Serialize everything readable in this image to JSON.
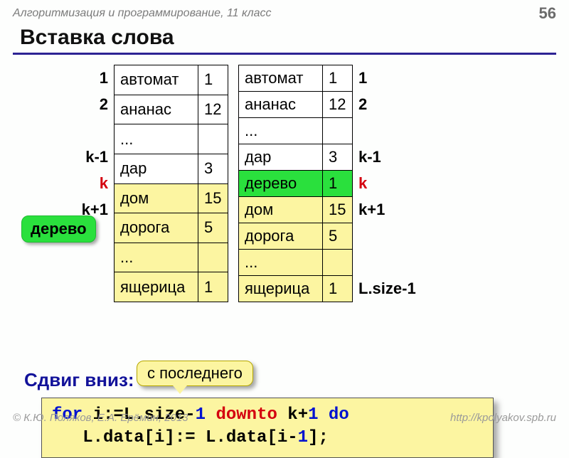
{
  "header": {
    "course": "Алгоритмизация и программирование, 11 класс",
    "page": "56"
  },
  "title": "Вставка слова",
  "left_indices": [
    "1",
    "2",
    "",
    "k-1",
    "k",
    "k+1",
    "",
    ""
  ],
  "left_red": [
    false,
    false,
    false,
    false,
    true,
    false,
    false,
    false
  ],
  "left_table": [
    {
      "w": "автомат",
      "n": "1",
      "hl": ""
    },
    {
      "w": "ананас",
      "n": "12",
      "hl": ""
    },
    {
      "w": "...",
      "n": "",
      "hl": ""
    },
    {
      "w": "дар",
      "n": "3",
      "hl": ""
    },
    {
      "w": "дом",
      "n": "15",
      "hl": "yellow"
    },
    {
      "w": "дорога",
      "n": "5",
      "hl": "yellow"
    },
    {
      "w": "...",
      "n": "",
      "hl": "yellow"
    },
    {
      "w": "ящерица",
      "n": "1",
      "hl": "yellow"
    }
  ],
  "right_table": [
    {
      "w": "автомат",
      "n": "1",
      "hl": ""
    },
    {
      "w": "ананас",
      "n": "12",
      "hl": ""
    },
    {
      "w": "...",
      "n": "",
      "hl": ""
    },
    {
      "w": "дар",
      "n": "3",
      "hl": ""
    },
    {
      "w": "дерево",
      "n": "1",
      "hl": "green"
    },
    {
      "w": "дом",
      "n": "15",
      "hl": "yellow"
    },
    {
      "w": "дорога",
      "n": "5",
      "hl": "yellow"
    },
    {
      "w": "...",
      "n": "",
      "hl": "yellow"
    },
    {
      "w": "ящерица",
      "n": "1",
      "hl": "yellow"
    }
  ],
  "right_indices": [
    "1",
    "2",
    "",
    "k-1",
    "k",
    "k+1",
    "",
    "",
    "L.size-1"
  ],
  "right_red": [
    false,
    false,
    false,
    false,
    true,
    false,
    false,
    false,
    false
  ],
  "tree_badge": "дерево",
  "shift_label": "Сдвиг вниз:",
  "from_last": "с последнего",
  "code": {
    "l1a": "for",
    "l1b": " i:=L.size-",
    "l1c": "1",
    "l1d": " downto",
    "l1e": " k+",
    "l1f": "1",
    "l1g": " do",
    "l2a": "   L.data[i]:= L.data[i-",
    "l2b": "1",
    "l2c": "];"
  },
  "footer": {
    "left": "© К.Ю. Поляков, Е.А. Ерёмин, 2013",
    "right": "http://kpolyakov.spb.ru"
  }
}
